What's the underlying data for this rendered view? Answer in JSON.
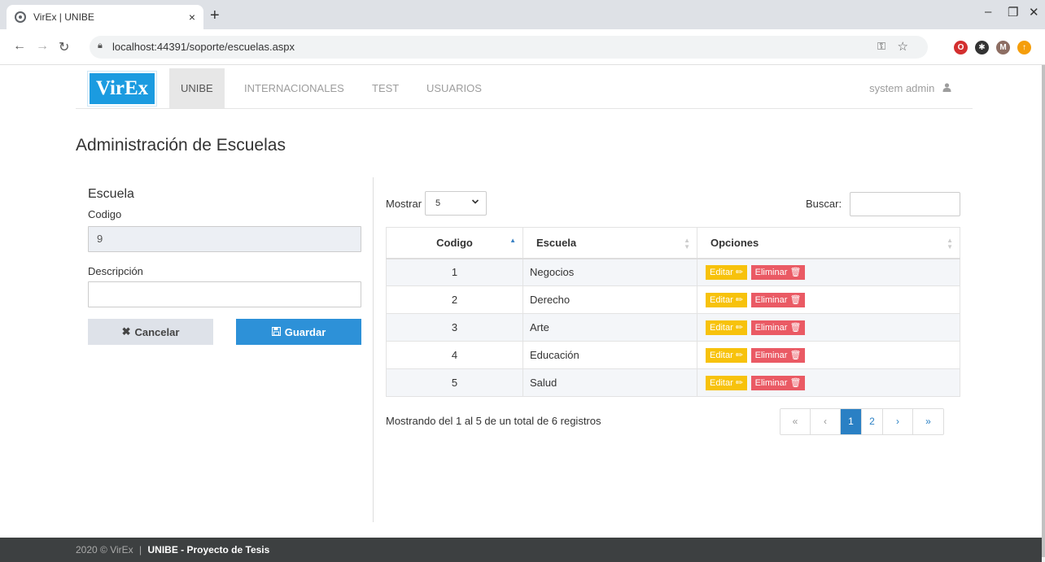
{
  "browser": {
    "tab_title": "VirEx | UNIBE",
    "tab_close": "×",
    "new_tab": "+",
    "url": "localhost:44391/soporte/escuelas.aspx",
    "window_controls": {
      "minimize": "–",
      "restore": "❐",
      "close": "✕"
    },
    "extensions": [
      {
        "name": "opera-icon",
        "color": "#d32f2f",
        "glyph": "O"
      },
      {
        "name": "extensions-puzzle-icon",
        "color": "#333333",
        "glyph": "✱"
      },
      {
        "name": "profile-avatar-icon",
        "color": "#8d6e63",
        "glyph": "M"
      },
      {
        "name": "update-icon",
        "color": "#f59e0b",
        "glyph": "↑"
      }
    ]
  },
  "navbar": {
    "brand": "VirEx",
    "links": [
      "UNIBE",
      "INTERNACIONALES",
      "TEST",
      "USUARIOS"
    ],
    "active": "UNIBE",
    "user": "system admin"
  },
  "page": {
    "title": "Administración de Escuelas"
  },
  "form": {
    "heading": "Escuela",
    "codigo_label": "Codigo",
    "codigo_value": "9",
    "descripcion_label": "Descripción",
    "descripcion_value": "",
    "cancel_label": "Cancelar",
    "save_label": "Guardar"
  },
  "table": {
    "length_label": "Mostrar",
    "length_value": "5",
    "search_label": "Buscar:",
    "search_value": "",
    "columns": [
      "Codigo",
      "Escuela",
      "Opciones"
    ],
    "rows": [
      {
        "codigo": "1",
        "escuela": "Negocios"
      },
      {
        "codigo": "2",
        "escuela": "Derecho"
      },
      {
        "codigo": "3",
        "escuela": "Arte"
      },
      {
        "codigo": "4",
        "escuela": "Educación"
      },
      {
        "codigo": "5",
        "escuela": "Salud"
      }
    ],
    "edit_label": "Editar",
    "delete_label": "Eliminar",
    "info": "Mostrando del 1 al 5 de un total de 6 registros",
    "pagination": {
      "first": "«",
      "prev": "‹",
      "pages": [
        "1",
        "2"
      ],
      "current": "1",
      "next": "›",
      "last": "»"
    }
  },
  "footer": {
    "copyright": "2020 © VirEx",
    "separator": "|",
    "project": "UNIBE - Proyecto de Tesis"
  },
  "colors": {
    "brand": "#1b9be0",
    "save_button": "#2d91d8",
    "edit_badge": "#f7c20c",
    "delete_badge": "#ea5a64",
    "pager_active": "#2a80c4",
    "footer": "#3d4041"
  }
}
